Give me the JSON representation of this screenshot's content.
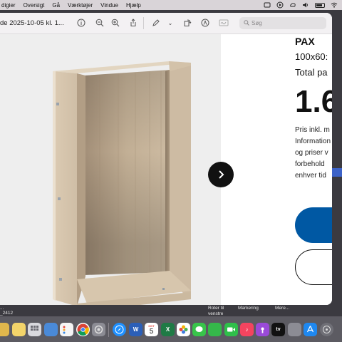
{
  "menubar": {
    "items": [
      "digier",
      "Oversigt",
      "Gå",
      "Værktøjer",
      "Vindue",
      "Hjælp"
    ]
  },
  "window": {
    "title": "de 2025-10-05 kl. 1...",
    "search_placeholder": "Søg"
  },
  "product": {
    "name": "PAX",
    "dimensions": "100x60:",
    "total_label": "Total pa",
    "price": "1.6",
    "info_lines": [
      "Pris inkl. m",
      "Information",
      "og priser v",
      "forbehold",
      "enhver tid"
    ]
  },
  "desktop": {
    "labels_left": [
      "...",
      "_2412"
    ],
    "action_rotate": "Roter til venstre",
    "action_mark": "Markering",
    "action_more": "Mere..."
  },
  "dock": {
    "calendar_day": "5",
    "items": [
      "folder-app",
      "notes-app",
      "launchpad-app",
      "reminders-app",
      "chrome-app",
      "system-settings-app",
      "safari-app",
      "word-app",
      "calendar-app",
      "excel-app",
      "photos-app",
      "messages-app",
      "facetime-app",
      "music-app",
      "podcasts-app",
      "tv-app",
      "appstore-app",
      "disk-utility-app"
    ]
  },
  "colors": {
    "ikea_blue": "#0058a3",
    "menubar_bg": "#d9d4d8"
  }
}
